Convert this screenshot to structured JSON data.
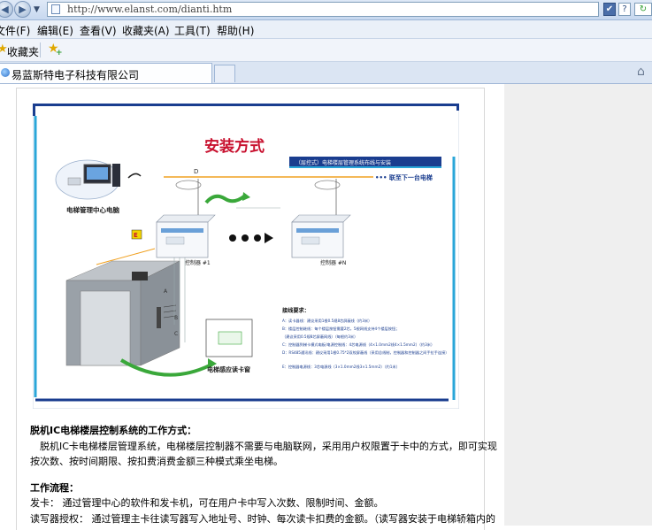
{
  "browser": {
    "url": "http://www.elanst.com/dianti.htm",
    "menu": [
      "文件(F)",
      "编辑(E)",
      "查看(V)",
      "收藏夹(A)",
      "工具(T)",
      "帮助(H)"
    ],
    "favorites_label": "收藏夹",
    "tab_title": "易蓝斯特电子科技有限公司"
  },
  "figure": {
    "title": "安装方式",
    "banner": "（层控式）电梯楼层管理系统布线与安装",
    "next_elevator": "••• 联至下一台电梯",
    "pc_label": "电梯管理中心电脑",
    "card_reader_label": "电梯感应读卡窗",
    "controller1_label": "控制器 #1",
    "controllerN_label": "控制器 #N",
    "wiring_title": "接线要求：",
    "wiring_lines": [
      "A：读卡器线：建议采用1根0.5规8芯屏蔽线（约3米）",
      "B：楼层控制继线：每个楼层按钮需要2芯，5根网线支持4个楼层按钮；",
      "    （建议采用0.5规8芯屏蔽网线）（每根约3米）",
      "C：控制器到梯卡模式电板/电源控制线：4芯电源线（4×1.0mm2线4×1.5mm2）（约3米）",
      "D：RS485通讯线：建议采用1根0.75*2双绞屏蔽线（采用总线制，控制器和控制器之间手拉手连接）",
      "E：控制器电源线：3芯电源线（3×1.0mm2线3×1.5mm2）（约1米）"
    ]
  },
  "article": {
    "heading1": "脱机IC电梯楼层控制系统的工作方式：",
    "para1_line1": "脱机IC卡电梯楼层管理系统，电梯楼层控制器不需要与电脑联网，采用用户权限置于卡中的方式，即可实现",
    "para1_line2": "按次数、按时间期限、按扣费消费金额三种模式乘坐电梯。",
    "heading2": "工作流程：",
    "line_issue": "发卡：  通过管理中心的软件和发卡机，可在用户卡中写入次数、限制时间、金额。",
    "line_auth": "读写器授权：  通过管理主卡往读写器写入地址号、时钟、每次读卡扣费的金额。（读写器安装于电梯轿箱内的"
  },
  "colors": {
    "accent_blue": "#1a3d8f",
    "title_red": "#c8102e",
    "wire_orange": "#f0a020",
    "wire_green": "#3aa83a"
  }
}
